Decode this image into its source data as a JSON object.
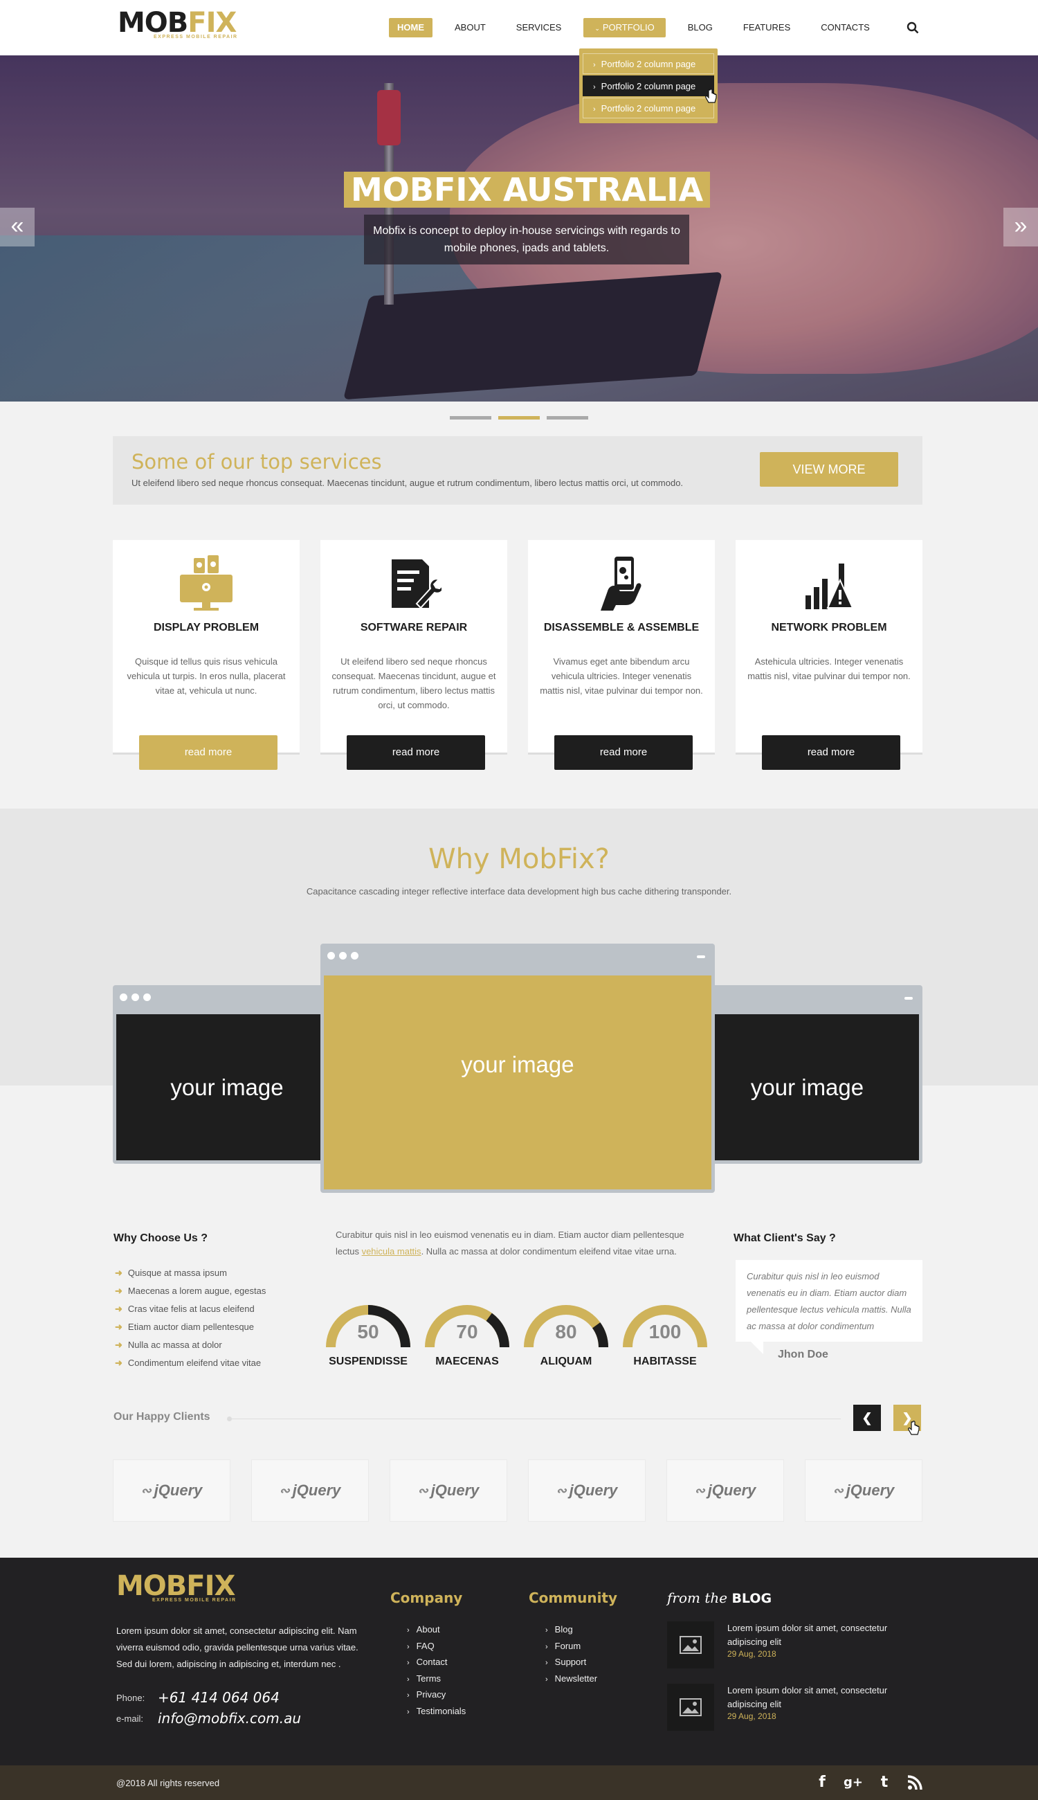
{
  "brand": {
    "logo_text_a": "MOB",
    "logo_text_b": "FIX",
    "tagline": "EXPRESS MOBILE REPAIR"
  },
  "nav": {
    "items": [
      "HOME",
      "ABOUT",
      "SERVICES",
      "PORTFOLIO",
      "BLOG",
      "FEATURES",
      "CONTACTS"
    ],
    "active": "HOME",
    "open": "PORTFOLIO",
    "dropdown": [
      "Portfolio 2 column page",
      "Portfolio 2 column page",
      "Portfolio 2 column page"
    ],
    "dropdown_selected_index": 1
  },
  "hero": {
    "title": "MOBFIX AUSTRALIA",
    "subtitle": "Mobfix is concept to deploy in-house servicings with regards to mobile phones, ipads and tablets.",
    "slides": 3,
    "active_slide": 2
  },
  "top_services": {
    "title": "Some of our top services",
    "text": "Ut eleifend libero sed neque rhoncus consequat. Maecenas tincidunt, augue et rutrum condimentum, libero lectus mattis orci, ut commodo.",
    "button": "VIEW MORE"
  },
  "services": [
    {
      "title": "DISPLAY PROBLEM",
      "text": "Quisque id tellus quis risus vehicula vehicula ut turpis. In eros nulla, placerat vitae at, vehicula ut nunc.",
      "button": "read more",
      "icon": "monitor-gears-icon",
      "highlight": true
    },
    {
      "title": "SOFTWARE REPAIR",
      "text": "Ut eleifend libero sed neque rhoncus consequat. Maecenas tincidunt, augue et rutrum condimentum, libero lectus mattis orci, ut commodo.",
      "button": "read more",
      "icon": "document-wrench-icon",
      "highlight": false
    },
    {
      "title": "DISASSEMBLE & ASSEMBLE",
      "text": "Vivamus eget ante bibendum arcu vehicula ultricies. Integer venenatis mattis nisl, vitae pulvinar dui tempor non.",
      "button": "read more",
      "icon": "hand-phone-icon",
      "highlight": false
    },
    {
      "title": "NETWORK PROBLEM",
      "text": "Astehicula ultricies. Integer venenatis mattis nisl, vitae pulvinar dui tempor non.",
      "button": "read more",
      "icon": "signal-warning-icon",
      "highlight": false
    }
  ],
  "why": {
    "title": "Why MobFix?",
    "subtitle": "Capacitance cascading integer reflective interface data development high bus cache dithering transponder.",
    "slides": [
      "your image",
      "your image",
      "your image"
    ]
  },
  "why_choose": {
    "title": "Why Choose Us ?",
    "items": [
      "Quisque at massa ipsum",
      "Maecenas a lorem augue, egestas",
      "Cras vitae felis at lacus eleifend",
      "Etiam auctor diam pellentesque",
      "Nulla ac massa at dolor",
      "Condimentum eleifend vitae vitae"
    ]
  },
  "middle": {
    "text_before": "Curabitur quis nisl in leo euismod venenatis eu in diam. Etiam auctor diam pellentesque lectus ",
    "link": "vehicula mattis",
    "text_after": ". Nulla ac massa at dolor condimentum eleifend vitae vitae urna."
  },
  "gauges": [
    {
      "value": 50,
      "label": "SUSPENDISSE"
    },
    {
      "value": 70,
      "label": "MAECENAS"
    },
    {
      "value": 80,
      "label": "ALIQUAM"
    },
    {
      "value": 100,
      "label": "HABITASSE"
    }
  ],
  "testimonial": {
    "title": "What Client's Say ?",
    "quote": "Curabitur quis nisl in leo euismod venenatis eu in diam. Etiam auctor diam pellentesque lectus vehicula mattis. Nulla ac massa at dolor condimentum",
    "author": "Jhon Doe"
  },
  "clients": {
    "title": "Our Happy Clients",
    "logos": [
      "jQuery",
      "jQuery",
      "jQuery",
      "jQuery",
      "jQuery",
      "jQuery"
    ]
  },
  "footer": {
    "about": "Lorem ipsum dolor sit amet, consectetur adipiscing elit. Nam viverra euismod odio, gravida pellentesque urna varius vitae. Sed dui lorem, adipiscing in adipiscing et, interdum nec .",
    "phone_label": "Phone:",
    "phone": "+61 414 064 064",
    "email_label": "e-mail:",
    "email": "info@mobfix.com.au",
    "company_title": "Company",
    "company_links": [
      "About",
      "FAQ",
      "Contact",
      "Terms",
      "Privacy",
      "Testimonials"
    ],
    "community_title": "Community",
    "community_links": [
      "Blog",
      "Forum",
      "Support",
      "Newsletter"
    ],
    "blog_title_prefix": "from the",
    "blog_title": "BLOG",
    "posts": [
      {
        "title": "Lorem ipsum dolor sit amet, consectetur adipiscing elit",
        "date": "29 Aug, 2018"
      },
      {
        "title": "Lorem ipsum dolor sit amet, consectetur adipiscing elit",
        "date": "29 Aug, 2018"
      }
    ],
    "copyright": "@2018 All rights reserved",
    "social": [
      "facebook-icon",
      "google-plus-icon",
      "twitter-icon",
      "rss-icon"
    ]
  },
  "colors": {
    "accent": "#cfb35a",
    "dark": "#1e1e1e",
    "footer": "#222123",
    "bottom_bar": "#3a3328"
  }
}
